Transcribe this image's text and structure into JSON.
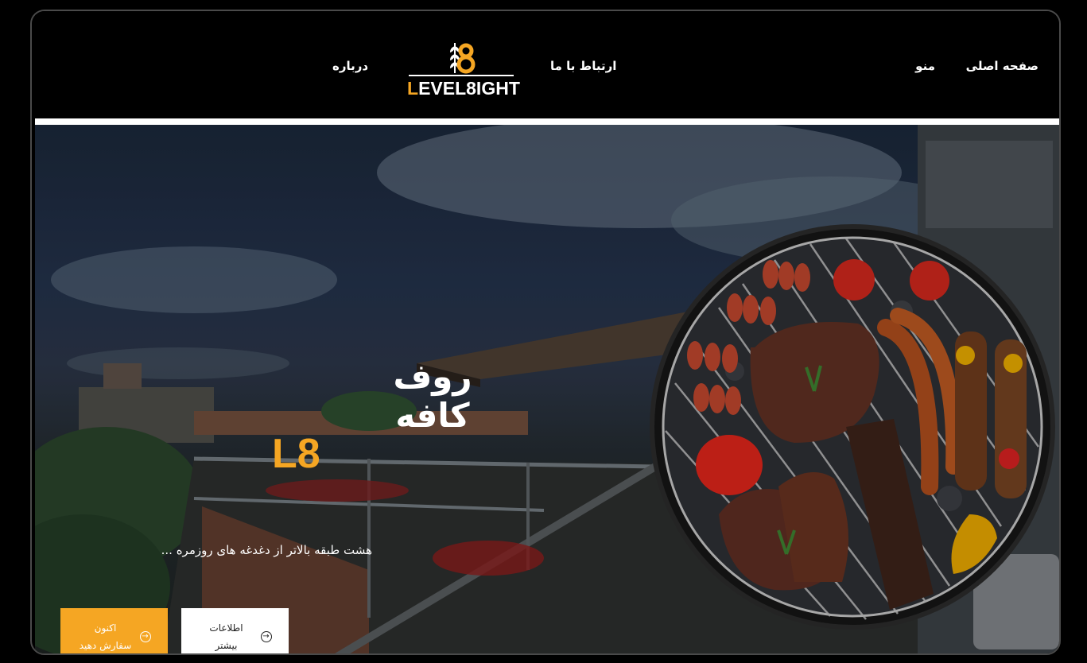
{
  "nav": {
    "home": "صفحه اصلی",
    "menu": "منو",
    "contact": "ارتباط با ما",
    "about": "درباره"
  },
  "logo": {
    "text_first": "L",
    "text_rest": "EVEL8IGHT",
    "icon": "wheat-8-logo-icon"
  },
  "hero": {
    "title": "روف کافه",
    "brand": "L8",
    "tagline": "هشت طبقه بالاتر از دغدغه های روزمره ..."
  },
  "buttons": {
    "order": "اکنون سفارش دهید",
    "more": "اطلاعات بیشتر",
    "order_icon": "arrow-circle-icon",
    "more_icon": "arrow-circle-icon"
  },
  "colors": {
    "accent": "#f5a623",
    "background": "#000000",
    "text": "#ffffff"
  }
}
